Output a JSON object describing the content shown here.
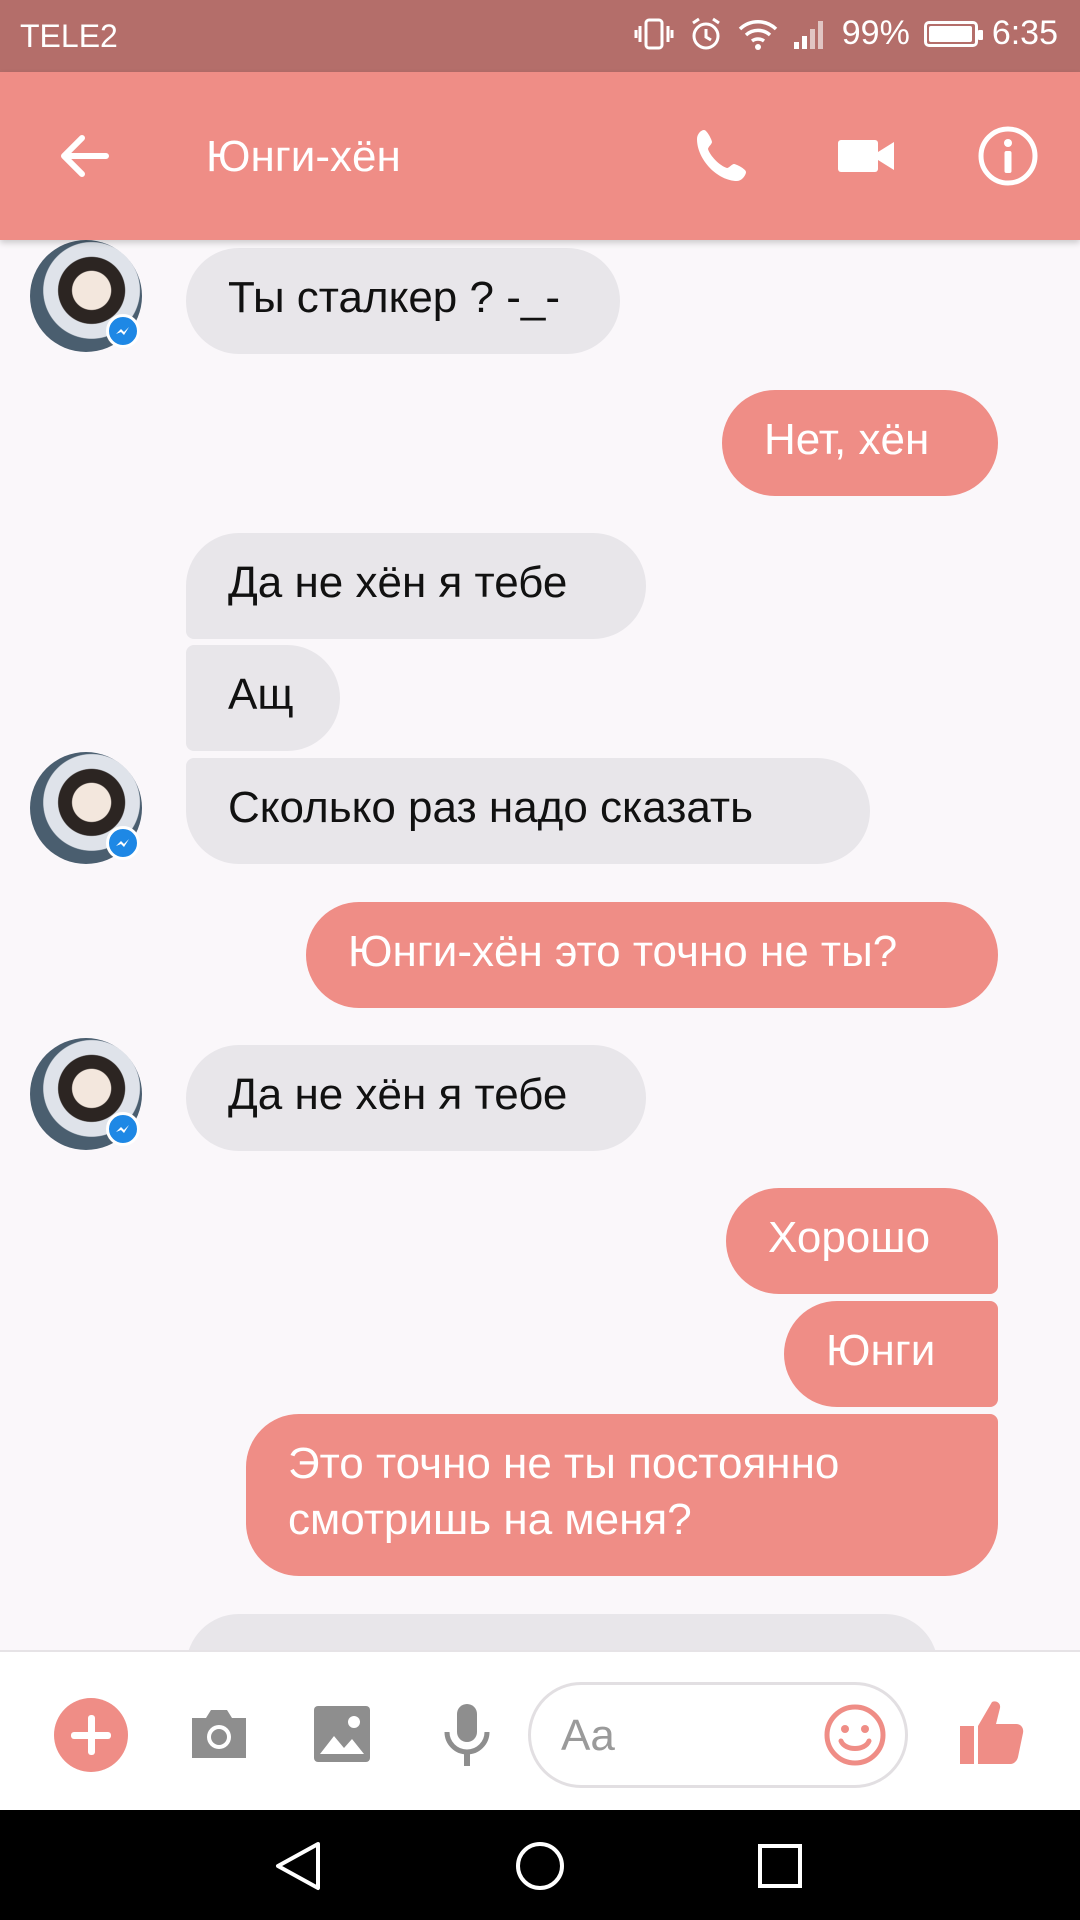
{
  "status_bar": {
    "carrier": "TELE2",
    "battery": "99%",
    "battery_level": 0.99,
    "time": "6:35"
  },
  "header": {
    "title": "Юнги-хён"
  },
  "messages": [
    {
      "side": "in",
      "text": "Ты сталкер ? -_-"
    },
    {
      "side": "out",
      "text": "Нет, хён"
    },
    {
      "side": "in",
      "text": "Да не хён я тебе"
    },
    {
      "side": "in",
      "text": "Ащ"
    },
    {
      "side": "in",
      "text": "Сколько раз надо сказать"
    },
    {
      "side": "out",
      "text": "Юнги-хён это точно не ты?"
    },
    {
      "side": "in",
      "text": "Да не хён я тебе"
    },
    {
      "side": "out",
      "text": "Хорошо"
    },
    {
      "side": "out",
      "text": "Юнги"
    },
    {
      "side": "out",
      "line1": "Это точно не ты постоянно",
      "line2": "смотришь на меня?"
    }
  ],
  "composer": {
    "placeholder": "Aa"
  },
  "colors": {
    "accent": "#ef8d86",
    "status_bar": "#b46e6a",
    "incoming_bubble": "#e8e6ea",
    "messenger_badge": "#1e88e5"
  },
  "icons": [
    "back-arrow-icon",
    "phone-icon",
    "video-camera-icon",
    "info-icon",
    "plus-icon",
    "camera-icon",
    "image-icon",
    "microphone-icon",
    "emoji-icon",
    "thumbs-up-icon",
    "nav-back-icon",
    "nav-home-icon",
    "nav-recents-icon"
  ]
}
